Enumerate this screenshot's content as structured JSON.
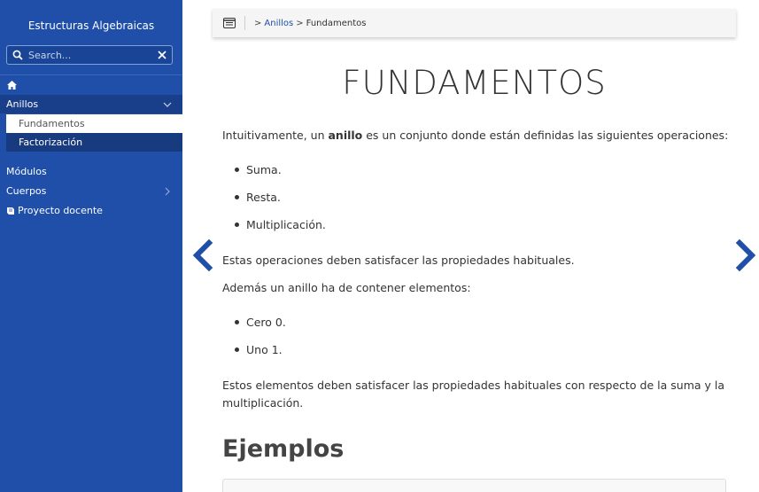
{
  "sidebar": {
    "site_title": "Estructuras Algebraicas",
    "search_placeholder": "Search...",
    "items": [
      {
        "label": "Anillos"
      },
      {
        "label": "Fundamentos"
      },
      {
        "label": "Factorización"
      },
      {
        "label": "Módulos"
      },
      {
        "label": "Cuerpos"
      },
      {
        "label": "Proyecto docente"
      }
    ]
  },
  "breadcrumb": {
    "sep1": ">",
    "link": "Anillos",
    "sep2": ">",
    "current": "Fundamentos"
  },
  "main": {
    "title": "FUNDAMENTOS",
    "intro_before": "Intuitivamente, un ",
    "intro_bold": "anillo",
    "intro_after": " es un conjunto donde están definidas las siguientes operaciones:",
    "ops": [
      "Suma.",
      "Resta.",
      "Multiplicación."
    ],
    "para2": "Estas operaciones deben satisfacer las propiedades habituales.",
    "para3": "Además un anillo ha de contener elementos:",
    "elements": [
      "Cero 0.",
      "Uno 1."
    ],
    "para4_line1": "Estos elementos deben satisfacer las propiedades habituales con respecto de la suma y la",
    "para4_line2": "multiplicación.",
    "section_heading": "Ejemplos"
  },
  "colors": {
    "sidebar_bg": "#1f4fa8",
    "accent": "#1f4fa8"
  },
  "icons": [
    "search-icon",
    "clear-icon",
    "home-icon",
    "chevron-down-icon",
    "chevron-right-icon",
    "book-icon",
    "menu-icon",
    "prev-arrow-icon",
    "next-arrow-icon"
  ]
}
